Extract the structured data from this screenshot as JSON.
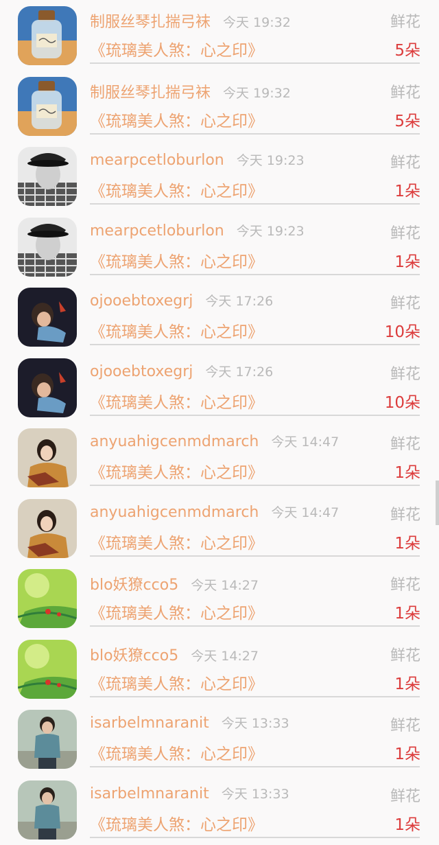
{
  "rows": [
    {
      "user": "制服丝琴扎揣弓袜",
      "time": "今天 19:32",
      "kind": "鲜花",
      "book": "《琉璃美人煞：心之印》",
      "count": "5朵",
      "avatar": "bottle"
    },
    {
      "user": "制服丝琴扎揣弓袜",
      "time": "今天 19:32",
      "kind": "鲜花",
      "book": "《琉璃美人煞：心之印》",
      "count": "5朵",
      "avatar": "bottle"
    },
    {
      "user": "mearpcetloburlon",
      "time": "今天 19:23",
      "kind": "鲜花",
      "book": "《琉璃美人煞：心之印》",
      "count": "1朵",
      "avatar": "man-hat"
    },
    {
      "user": "mearpcetloburlon",
      "time": "今天 19:23",
      "kind": "鲜花",
      "book": "《琉璃美人煞：心之印》",
      "count": "1朵",
      "avatar": "man-hat"
    },
    {
      "user": "ojooebtoxegrj",
      "time": "今天 17:26",
      "kind": "鲜花",
      "book": "《琉璃美人煞：心之印》",
      "count": "10朵",
      "avatar": "dark-girl"
    },
    {
      "user": "ojooebtoxegrj",
      "time": "今天 17:26",
      "kind": "鲜花",
      "book": "《琉璃美人煞：心之印》",
      "count": "10朵",
      "avatar": "dark-girl"
    },
    {
      "user": "anyuahigcenmdmarch",
      "time": "今天 14:47",
      "kind": "鲜花",
      "book": "《琉璃美人煞：心之印》",
      "count": "1朵",
      "avatar": "girl-scarf"
    },
    {
      "user": "anyuahigcenmdmarch",
      "time": "今天 14:47",
      "kind": "鲜花",
      "book": "《琉璃美人煞：心之印》",
      "count": "1朵",
      "avatar": "girl-scarf"
    },
    {
      "user": "blo妖獠cco5",
      "time": "今天 14:27",
      "kind": "鲜花",
      "book": "《琉璃美人煞：心之印》",
      "count": "1朵",
      "avatar": "green-leaf"
    },
    {
      "user": "blo妖獠cco5",
      "time": "今天 14:27",
      "kind": "鲜花",
      "book": "《琉璃美人煞：心之印》",
      "count": "1朵",
      "avatar": "green-leaf"
    },
    {
      "user": "isarbelmnaranit",
      "time": "今天 13:33",
      "kind": "鲜花",
      "book": "《琉璃美人煞：心之印》",
      "count": "1朵",
      "avatar": "young-man"
    },
    {
      "user": "isarbelmnaranit",
      "time": "今天 13:33",
      "kind": "鲜花",
      "book": "《琉璃美人煞：心之印》",
      "count": "1朵",
      "avatar": "young-man"
    }
  ],
  "colors": {
    "username": "#eda371",
    "book": "#eda371",
    "count": "#dc3c3c",
    "muted": "#b9b9b9",
    "background": "#faf9f9"
  }
}
